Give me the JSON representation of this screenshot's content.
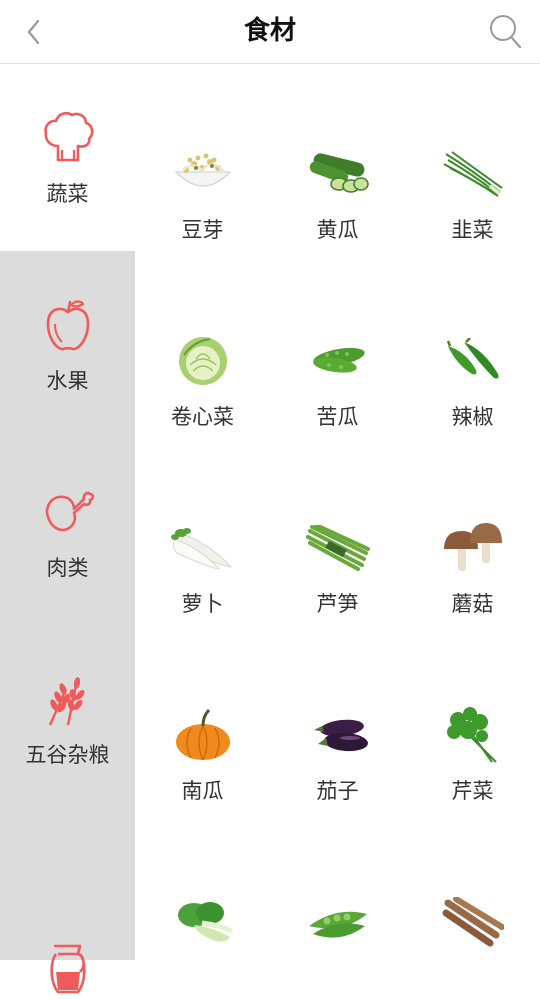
{
  "header": {
    "title": "食材",
    "back_icon": "chevron-left-icon",
    "search_icon": "search-icon"
  },
  "colors": {
    "accent": "#ef5b5b",
    "sidebar_bg": "#dcdcdc",
    "active_bg": "#ffffff"
  },
  "sidebar": {
    "items": [
      {
        "label": "蔬菜",
        "icon": "vegetable-icon",
        "active": true
      },
      {
        "label": "水果",
        "icon": "apple-icon",
        "active": false
      },
      {
        "label": "肉类",
        "icon": "meat-drumstick-icon",
        "active": false
      },
      {
        "label": "五谷杂粮",
        "icon": "wheat-icon",
        "active": false
      },
      {
        "label": "",
        "icon": "juice-pitcher-icon",
        "active": false
      }
    ]
  },
  "ingredients": [
    {
      "name": "豆芽",
      "icon": "bean-sprout-icon"
    },
    {
      "name": "黄瓜",
      "icon": "cucumber-icon"
    },
    {
      "name": "韭菜",
      "icon": "chive-icon"
    },
    {
      "name": "卷心菜",
      "icon": "cabbage-icon"
    },
    {
      "name": "苦瓜",
      "icon": "bitter-melon-icon"
    },
    {
      "name": "辣椒",
      "icon": "chili-pepper-icon"
    },
    {
      "name": "萝卜",
      "icon": "radish-icon"
    },
    {
      "name": "芦笋",
      "icon": "asparagus-icon"
    },
    {
      "name": "蘑菇",
      "icon": "mushroom-icon"
    },
    {
      "name": "南瓜",
      "icon": "pumpkin-icon"
    },
    {
      "name": "茄子",
      "icon": "eggplant-icon"
    },
    {
      "name": "芹菜",
      "icon": "celery-icon"
    },
    {
      "name": "",
      "icon": "bok-choy-icon"
    },
    {
      "name": "",
      "icon": "pea-pod-icon"
    },
    {
      "name": "",
      "icon": "yam-icon"
    }
  ]
}
